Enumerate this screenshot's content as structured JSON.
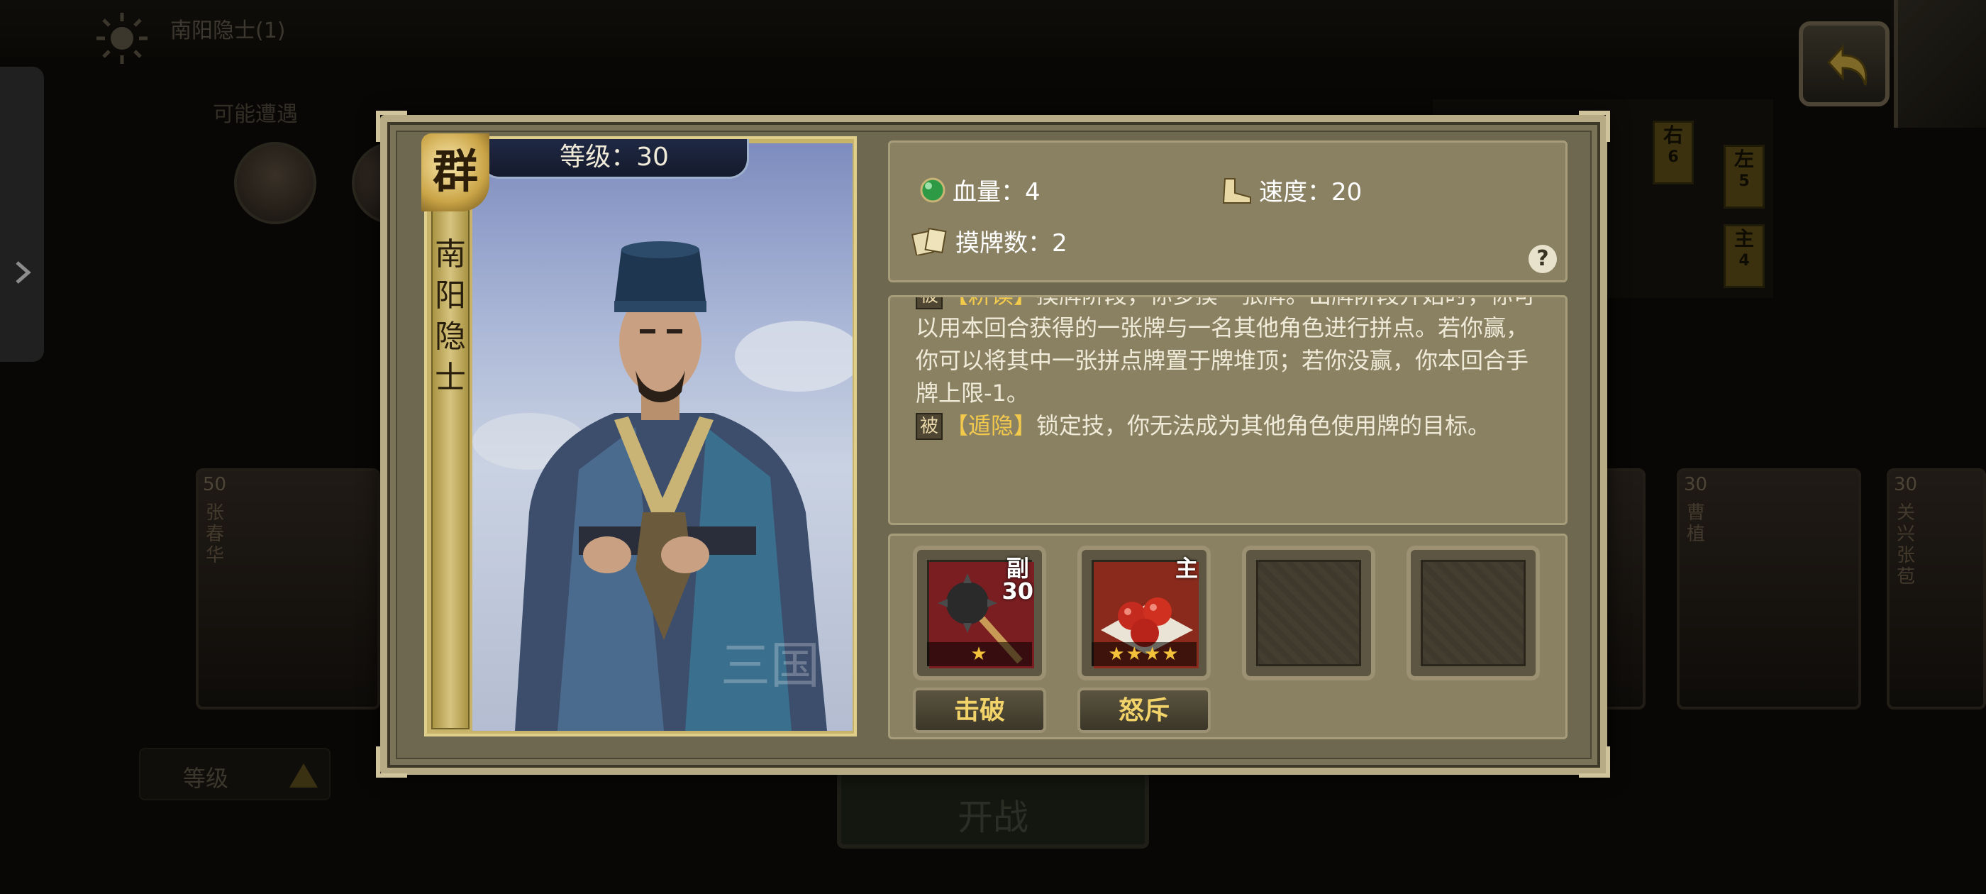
{
  "background": {
    "mode_title": "南阳隐士(1)",
    "maybe_encounter": "可能遭遇",
    "seats": [
      {
        "label": "右",
        "number": "6"
      },
      {
        "label": "左",
        "number": "5"
      },
      {
        "label": "主",
        "number": "4"
      }
    ],
    "cards": [
      {
        "level": "50",
        "name": "张春华"
      },
      {
        "level": "30",
        "name": "曹植"
      },
      {
        "level": "30",
        "name": "关兴张苞"
      }
    ],
    "sort_label": "等级",
    "start_label": "开战"
  },
  "hero": {
    "faction": "群",
    "name_vertical": "南\n阳\n隐\n士",
    "level_label": "等级：",
    "level_value": "30"
  },
  "stats": {
    "hp_label": "血量：",
    "hp_value": "4",
    "speed_label": "速度：",
    "speed_value": "20",
    "draw_label": "摸牌数：",
    "draw_value": "2",
    "help": "?"
  },
  "skills": {
    "skill1_tag": "被",
    "skill1_name": "【耕读】",
    "skill1_text_visible": "摸牌阶段，你多摸一张牌。出牌阶段开始时，你可以用本回合获得的一张牌与一名其他角色进行拼点。若你赢，你可以将其中一张拼点牌置于牌堆顶；若你没赢，你本回合手牌上限-1。",
    "skill2_tag": "被",
    "skill2_name": "【遁隐】",
    "skill2_text": "锁定技，你无法成为其他角色使用牌的目标。"
  },
  "equipment": {
    "slots": [
      {
        "tag": "副\n30",
        "stars": "★",
        "button": "击破",
        "icon": "flail-weapon-icon"
      },
      {
        "tag": "主",
        "stars": "★★★★",
        "button": "怒斥",
        "icon": "red-fruits-icon"
      },
      {
        "tag": "",
        "stars": "",
        "button": "",
        "icon": "empty-slot-icon"
      },
      {
        "tag": "",
        "stars": "",
        "button": "",
        "icon": "empty-slot-icon"
      }
    ]
  },
  "colors": {
    "accent_gold": "#f2c94c",
    "panel": "#8a8163",
    "frame": "#b6ab85"
  }
}
